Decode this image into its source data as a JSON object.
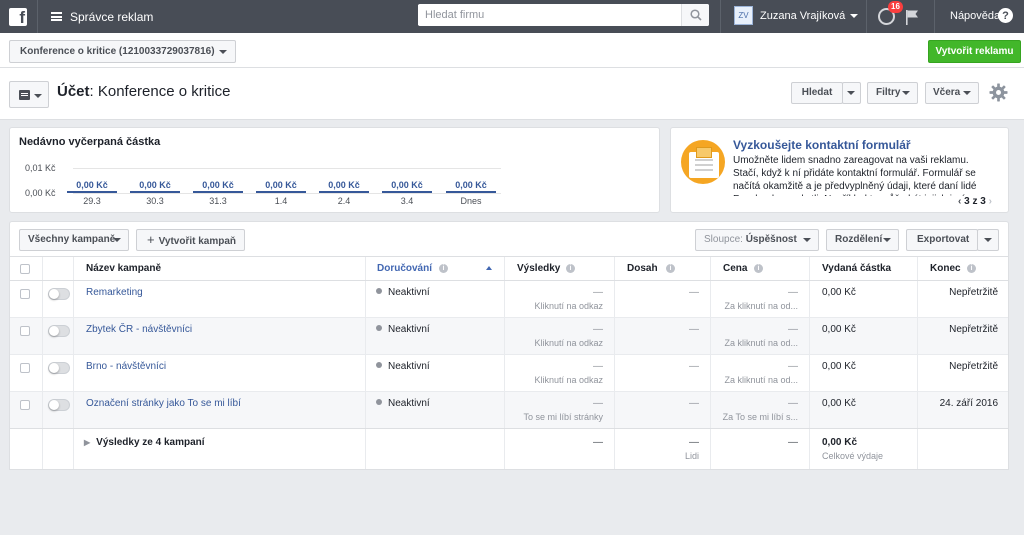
{
  "topbar": {
    "app_title": "Správce reklam",
    "search_placeholder": "Hledat firmu",
    "user_initials": "ZV",
    "user_name": "Zuzana Vrajíková",
    "notifications_count": "16",
    "help_label": "Nápověda",
    "help_glyph": "?"
  },
  "account": {
    "selector_label": "Konference o kritice (1210033729037816)",
    "create_ad_label": "Vytvořit reklamu"
  },
  "header": {
    "title_prefix": "Účet",
    "title_name": ": Konference o kritice",
    "search_label": "Hledat",
    "filters_label": "Filtry",
    "date_label": "Včera"
  },
  "spend_card": {
    "title": "Nedávno vyčerpaná částka",
    "y_labels": [
      "0,01 Kč",
      "0,00 Kč"
    ],
    "columns": [
      {
        "value": "0,00 Kč",
        "date": "29.3"
      },
      {
        "value": "0,00 Kč",
        "date": "30.3"
      },
      {
        "value": "0,00 Kč",
        "date": "31.3"
      },
      {
        "value": "0,00 Kč",
        "date": "1.4"
      },
      {
        "value": "0,00 Kč",
        "date": "2.4"
      },
      {
        "value": "0,00 Kč",
        "date": "3.4"
      },
      {
        "value": "0,00 Kč",
        "date": "Dnes"
      }
    ]
  },
  "promo_card": {
    "title": "Vyzkoušejte kontaktní formulář",
    "text": "Umožněte lidem snadno zareagovat na vaši reklamu. Stačí, když k ní přidáte kontaktní formulář. Formulář se načítá okamžitě a je předvyplněný údaji, které daní lidé Facebooku poskytli. Například to může být jejich jméno a adresa.",
    "pager": "3 z 3"
  },
  "toolbar": {
    "all_campaigns_label": "Všechny kampaně",
    "create_campaign_label": "Vytvořit kampaň",
    "columns_prefix": "Sloupce:",
    "columns_value": "Úspěšnost",
    "breakdown_label": "Rozdělení",
    "export_label": "Exportovat"
  },
  "table": {
    "headers": {
      "name": "Název kampaně",
      "delivery": "Doručování",
      "results": "Výsledky",
      "reach": "Dosah",
      "price": "Cena",
      "spent": "Vydaná částka",
      "end": "Konec"
    },
    "rows": [
      {
        "name": "Remarketing",
        "delivery": "Neaktivní",
        "results": "—",
        "results_sub": "Kliknutí na odkaz",
        "reach": "—",
        "price": "—",
        "price_sub": "Za kliknutí na od...",
        "spent": "0,00 Kč",
        "end": "Nepřetržitě"
      },
      {
        "name": "Zbytek ČR - návštěvníci",
        "delivery": "Neaktivní",
        "results": "—",
        "results_sub": "Kliknutí na odkaz",
        "reach": "—",
        "price": "—",
        "price_sub": "Za kliknutí na od...",
        "spent": "0,00 Kč",
        "end": "Nepřetržitě"
      },
      {
        "name": "Brno - návštěvníci",
        "delivery": "Neaktivní",
        "results": "—",
        "results_sub": "Kliknutí na odkaz",
        "reach": "—",
        "price": "—",
        "price_sub": "Za kliknutí na od...",
        "spent": "0,00 Kč",
        "end": "Nepřetržitě"
      },
      {
        "name": "Označení stránky jako To se mi líbí",
        "delivery": "Neaktivní",
        "results": "—",
        "results_sub": "To se mi líbí stránky",
        "reach": "—",
        "price": "—",
        "price_sub": "Za To se mi líbí s...",
        "spent": "0,00 Kč",
        "end": "24. září 2016"
      }
    ],
    "summary": {
      "label": "Výsledky ze 4 kampaní",
      "results": "—",
      "reach": "—",
      "reach_sub": "Lidi",
      "price": "—",
      "spent": "0,00 Kč",
      "spent_sub": "Celkové výdaje"
    }
  }
}
